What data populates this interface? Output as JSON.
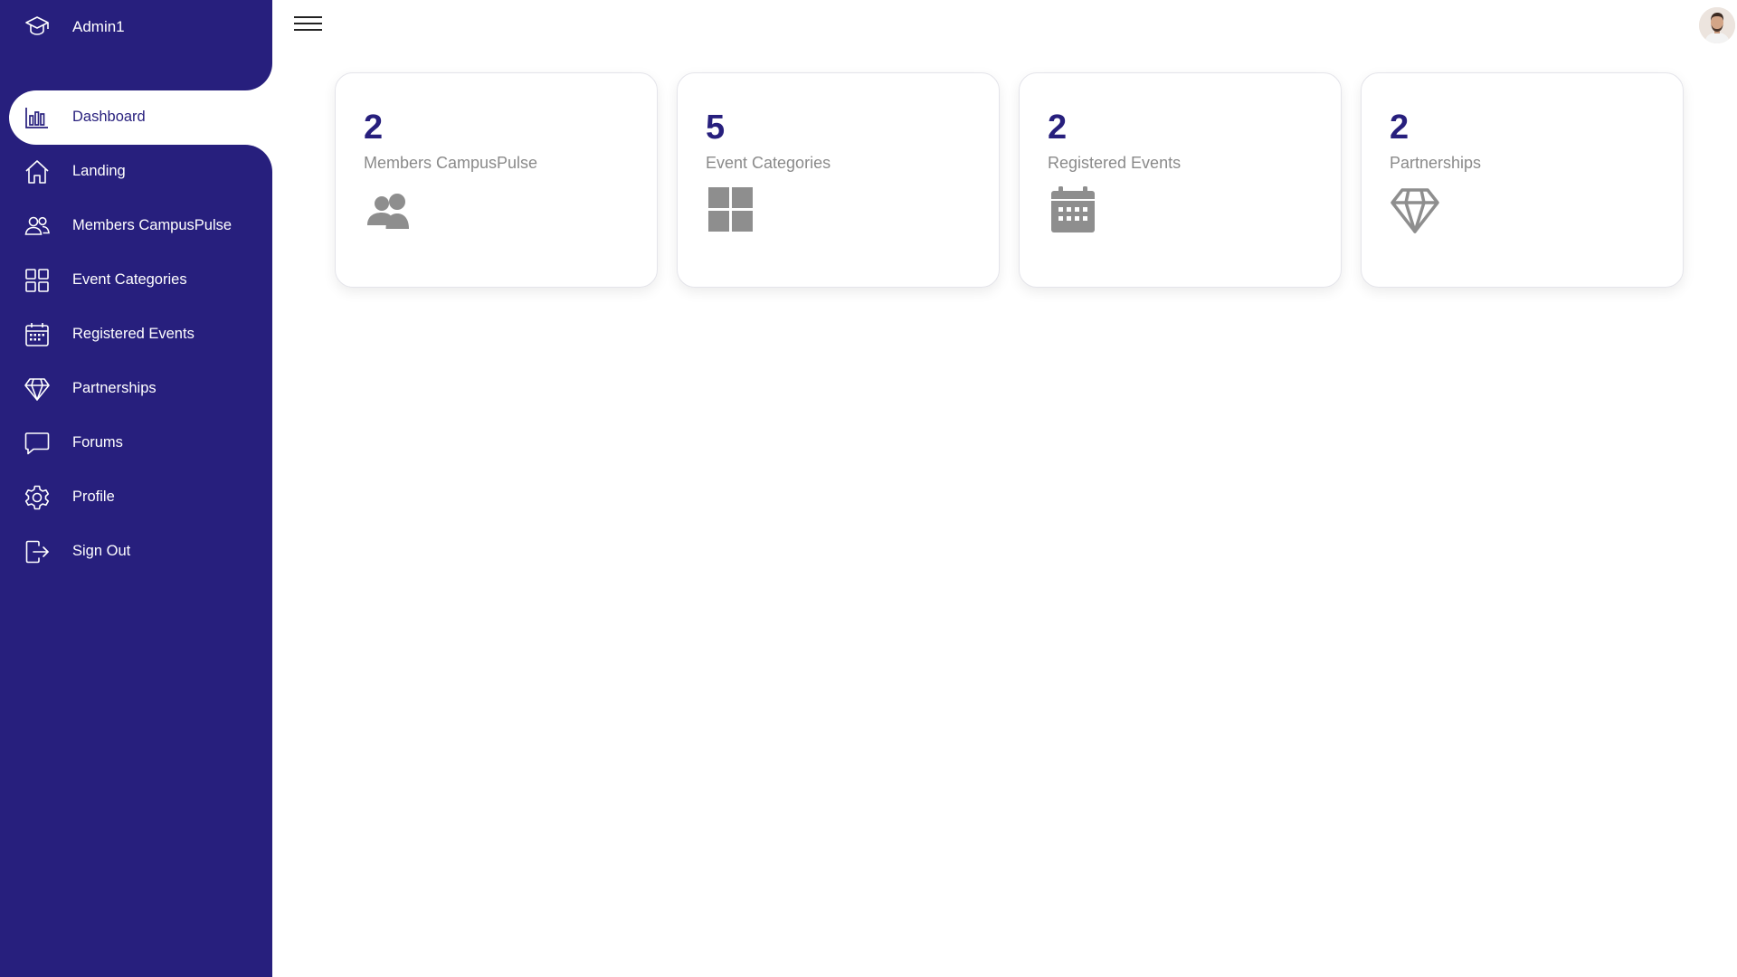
{
  "brand": {
    "label": "Admin1",
    "icon": "graduation-cap-icon"
  },
  "nav": {
    "items": [
      {
        "label": "Dashboard",
        "icon": "bar-chart-icon",
        "active": true
      },
      {
        "label": "Landing",
        "icon": "home-icon"
      },
      {
        "label": "Members CampusPulse",
        "icon": "users-icon"
      },
      {
        "label": "Event Categories",
        "icon": "grid-icon"
      },
      {
        "label": "Registered Events",
        "icon": "calendar-icon"
      },
      {
        "label": "Partnerships",
        "icon": "diamond-icon"
      },
      {
        "label": "Forums",
        "icon": "chat-icon"
      },
      {
        "label": "Profile",
        "icon": "gear-icon"
      },
      {
        "label": "Sign Out",
        "icon": "logout-icon"
      }
    ]
  },
  "topbar": {
    "menu_icon": "hamburger-menu-icon",
    "avatar": "user-avatar"
  },
  "cards": [
    {
      "value": "2",
      "title": "Members CampusPulse",
      "icon": "users-icon"
    },
    {
      "value": "5",
      "title": "Event Categories",
      "icon": "grid-icon"
    },
    {
      "value": "2",
      "title": "Registered Events",
      "icon": "calendar-icon"
    },
    {
      "value": "2",
      "title": "Partnerships",
      "icon": "diamond-icon"
    }
  ],
  "colors": {
    "sidebar": "#271f7d",
    "accent_text": "#271f7d",
    "muted_text": "#8a8a8a",
    "icon_gray": "#8e8e8e"
  }
}
